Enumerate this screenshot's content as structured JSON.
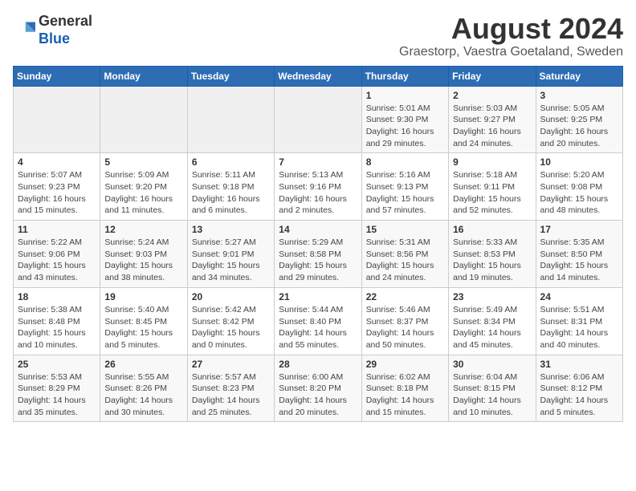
{
  "header": {
    "logo_line1": "General",
    "logo_line2": "Blue",
    "main_title": "August 2024",
    "subtitle": "Graestorp, Vaestra Goetaland, Sweden"
  },
  "weekdays": [
    "Sunday",
    "Monday",
    "Tuesday",
    "Wednesday",
    "Thursday",
    "Friday",
    "Saturday"
  ],
  "weeks": [
    [
      {
        "day": "",
        "info": ""
      },
      {
        "day": "",
        "info": ""
      },
      {
        "day": "",
        "info": ""
      },
      {
        "day": "",
        "info": ""
      },
      {
        "day": "1",
        "info": "Sunrise: 5:01 AM\nSunset: 9:30 PM\nDaylight: 16 hours\nand 29 minutes."
      },
      {
        "day": "2",
        "info": "Sunrise: 5:03 AM\nSunset: 9:27 PM\nDaylight: 16 hours\nand 24 minutes."
      },
      {
        "day": "3",
        "info": "Sunrise: 5:05 AM\nSunset: 9:25 PM\nDaylight: 16 hours\nand 20 minutes."
      }
    ],
    [
      {
        "day": "4",
        "info": "Sunrise: 5:07 AM\nSunset: 9:23 PM\nDaylight: 16 hours\nand 15 minutes."
      },
      {
        "day": "5",
        "info": "Sunrise: 5:09 AM\nSunset: 9:20 PM\nDaylight: 16 hours\nand 11 minutes."
      },
      {
        "day": "6",
        "info": "Sunrise: 5:11 AM\nSunset: 9:18 PM\nDaylight: 16 hours\nand 6 minutes."
      },
      {
        "day": "7",
        "info": "Sunrise: 5:13 AM\nSunset: 9:16 PM\nDaylight: 16 hours\nand 2 minutes."
      },
      {
        "day": "8",
        "info": "Sunrise: 5:16 AM\nSunset: 9:13 PM\nDaylight: 15 hours\nand 57 minutes."
      },
      {
        "day": "9",
        "info": "Sunrise: 5:18 AM\nSunset: 9:11 PM\nDaylight: 15 hours\nand 52 minutes."
      },
      {
        "day": "10",
        "info": "Sunrise: 5:20 AM\nSunset: 9:08 PM\nDaylight: 15 hours\nand 48 minutes."
      }
    ],
    [
      {
        "day": "11",
        "info": "Sunrise: 5:22 AM\nSunset: 9:06 PM\nDaylight: 15 hours\nand 43 minutes."
      },
      {
        "day": "12",
        "info": "Sunrise: 5:24 AM\nSunset: 9:03 PM\nDaylight: 15 hours\nand 38 minutes."
      },
      {
        "day": "13",
        "info": "Sunrise: 5:27 AM\nSunset: 9:01 PM\nDaylight: 15 hours\nand 34 minutes."
      },
      {
        "day": "14",
        "info": "Sunrise: 5:29 AM\nSunset: 8:58 PM\nDaylight: 15 hours\nand 29 minutes."
      },
      {
        "day": "15",
        "info": "Sunrise: 5:31 AM\nSunset: 8:56 PM\nDaylight: 15 hours\nand 24 minutes."
      },
      {
        "day": "16",
        "info": "Sunrise: 5:33 AM\nSunset: 8:53 PM\nDaylight: 15 hours\nand 19 minutes."
      },
      {
        "day": "17",
        "info": "Sunrise: 5:35 AM\nSunset: 8:50 PM\nDaylight: 15 hours\nand 14 minutes."
      }
    ],
    [
      {
        "day": "18",
        "info": "Sunrise: 5:38 AM\nSunset: 8:48 PM\nDaylight: 15 hours\nand 10 minutes."
      },
      {
        "day": "19",
        "info": "Sunrise: 5:40 AM\nSunset: 8:45 PM\nDaylight: 15 hours\nand 5 minutes."
      },
      {
        "day": "20",
        "info": "Sunrise: 5:42 AM\nSunset: 8:42 PM\nDaylight: 15 hours\nand 0 minutes."
      },
      {
        "day": "21",
        "info": "Sunrise: 5:44 AM\nSunset: 8:40 PM\nDaylight: 14 hours\nand 55 minutes."
      },
      {
        "day": "22",
        "info": "Sunrise: 5:46 AM\nSunset: 8:37 PM\nDaylight: 14 hours\nand 50 minutes."
      },
      {
        "day": "23",
        "info": "Sunrise: 5:49 AM\nSunset: 8:34 PM\nDaylight: 14 hours\nand 45 minutes."
      },
      {
        "day": "24",
        "info": "Sunrise: 5:51 AM\nSunset: 8:31 PM\nDaylight: 14 hours\nand 40 minutes."
      }
    ],
    [
      {
        "day": "25",
        "info": "Sunrise: 5:53 AM\nSunset: 8:29 PM\nDaylight: 14 hours\nand 35 minutes."
      },
      {
        "day": "26",
        "info": "Sunrise: 5:55 AM\nSunset: 8:26 PM\nDaylight: 14 hours\nand 30 minutes."
      },
      {
        "day": "27",
        "info": "Sunrise: 5:57 AM\nSunset: 8:23 PM\nDaylight: 14 hours\nand 25 minutes."
      },
      {
        "day": "28",
        "info": "Sunrise: 6:00 AM\nSunset: 8:20 PM\nDaylight: 14 hours\nand 20 minutes."
      },
      {
        "day": "29",
        "info": "Sunrise: 6:02 AM\nSunset: 8:18 PM\nDaylight: 14 hours\nand 15 minutes."
      },
      {
        "day": "30",
        "info": "Sunrise: 6:04 AM\nSunset: 8:15 PM\nDaylight: 14 hours\nand 10 minutes."
      },
      {
        "day": "31",
        "info": "Sunrise: 6:06 AM\nSunset: 8:12 PM\nDaylight: 14 hours\nand 5 minutes."
      }
    ]
  ]
}
